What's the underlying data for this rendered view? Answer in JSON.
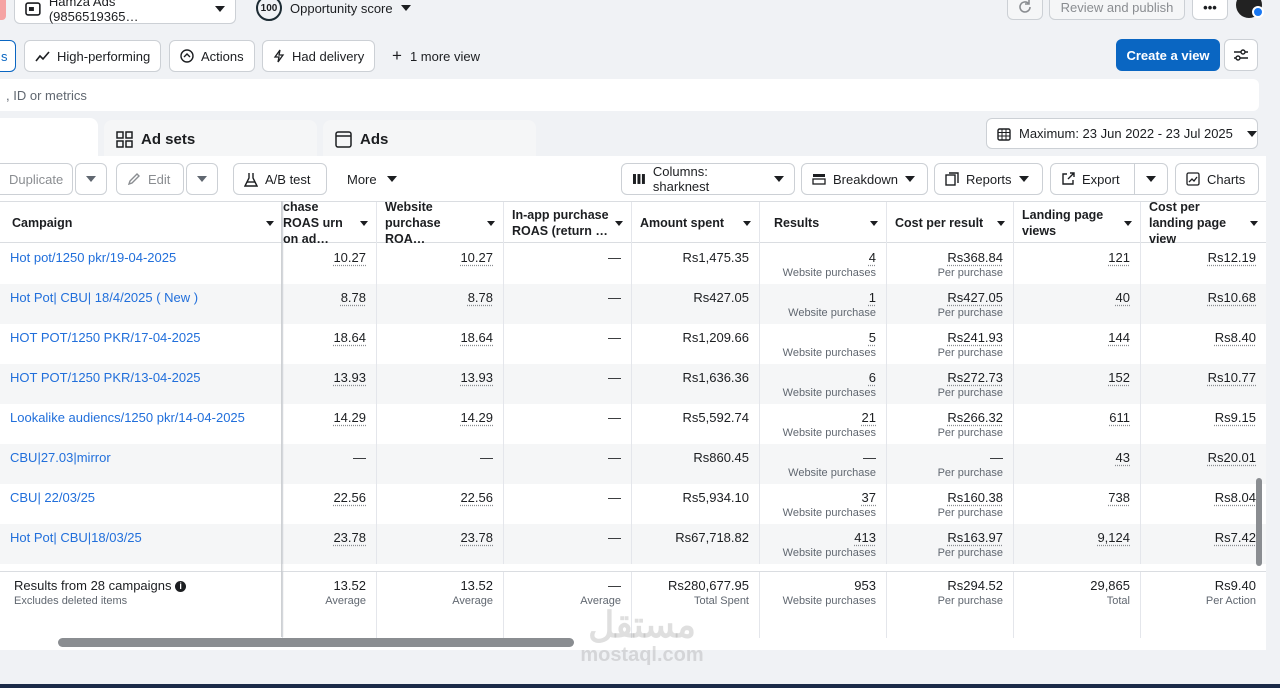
{
  "topbar": {
    "account": "Hamza Ads (9856519365…",
    "opportunity_score": "100",
    "opportunity_label": "Opportunity score",
    "review_publish": "Review and publish",
    "more_dots": "•••"
  },
  "views": {
    "truncated_first": "s",
    "high_performing": "High-performing",
    "actions": "Actions",
    "had_delivery": "Had delivery",
    "more_view": "1 more view",
    "create_view": "Create a view"
  },
  "search": {
    "placeholder": ", ID or metrics"
  },
  "level_tabs": {
    "ad_sets": "Ad sets",
    "ads": "Ads"
  },
  "date_range": "Maximum: 23 Jun 2022 - 23 Jul 2025",
  "toolbar": {
    "duplicate": "Duplicate",
    "edit": "Edit",
    "ab_test": "A/B test",
    "more": "More",
    "columns": "Columns: sharknest",
    "breakdown": "Breakdown",
    "reports": "Reports",
    "export": "Export",
    "charts": "Charts"
  },
  "table": {
    "headers": {
      "campaign": "Campaign",
      "purchase_roas": "chase ROAS urn on ad…",
      "website_roas": "Website purchase ROA…",
      "inapp_roas": "In-app purchase ROAS (return …",
      "amount_spent": "Amount spent",
      "results": "Results",
      "cost_per_result": "Cost per result",
      "lp_views": "Landing page views",
      "cost_per_lpv": "Cost per landing page view"
    },
    "rows": [
      {
        "campaign": "Hot pot/1250 pkr/19-04-2025",
        "roas": "10.27",
        "web_roas": "10.27",
        "inapp": "—",
        "spent": "Rs1,475.35",
        "results": "4",
        "results_sub": "Website purchases",
        "cpr": "Rs368.84",
        "cpr_sub": "Per purchase",
        "lpv": "121",
        "cplpv": "Rs12.19"
      },
      {
        "campaign": "Hot Pot| CBU| 18/4/2025 ( New )",
        "roas": "8.78",
        "web_roas": "8.78",
        "inapp": "—",
        "spent": "Rs427.05",
        "results": "1",
        "results_sub": "Website purchase",
        "cpr": "Rs427.05",
        "cpr_sub": "Per purchase",
        "lpv": "40",
        "cplpv": "Rs10.68"
      },
      {
        "campaign": "HOT POT/1250 PKR/17-04-2025",
        "roas": "18.64",
        "web_roas": "18.64",
        "inapp": "—",
        "spent": "Rs1,209.66",
        "results": "5",
        "results_sub": "Website purchases",
        "cpr": "Rs241.93",
        "cpr_sub": "Per purchase",
        "lpv": "144",
        "cplpv": "Rs8.40"
      },
      {
        "campaign": "HOT POT/1250 PKR/13-04-2025",
        "roas": "13.93",
        "web_roas": "13.93",
        "inapp": "—",
        "spent": "Rs1,636.36",
        "results": "6",
        "results_sub": "Website purchases",
        "cpr": "Rs272.73",
        "cpr_sub": "Per purchase",
        "lpv": "152",
        "cplpv": "Rs10.77"
      },
      {
        "campaign": "Lookalike audiencs/1250 pkr/14-04-2025",
        "roas": "14.29",
        "web_roas": "14.29",
        "inapp": "—",
        "spent": "Rs5,592.74",
        "results": "21",
        "results_sub": "Website purchases",
        "cpr": "Rs266.32",
        "cpr_sub": "Per purchase",
        "lpv": "611",
        "cplpv": "Rs9.15"
      },
      {
        "campaign": "CBU|27.03|mirror",
        "roas": "—",
        "web_roas": "—",
        "inapp": "—",
        "spent": "Rs860.45",
        "results": "—",
        "results_sub": "Website purchase",
        "cpr": "—",
        "cpr_sub": "Per purchase",
        "lpv": "43",
        "cplpv": "Rs20.01"
      },
      {
        "campaign": "CBU| 22/03/25",
        "roas": "22.56",
        "web_roas": "22.56",
        "inapp": "—",
        "spent": "Rs5,934.10",
        "results": "37",
        "results_sub": "Website purchases",
        "cpr": "Rs160.38",
        "cpr_sub": "Per purchase",
        "lpv": "738",
        "cplpv": "Rs8.04"
      },
      {
        "campaign": "Hot Pot| CBU|18/03/25",
        "roas": "23.78",
        "web_roas": "23.78",
        "inapp": "—",
        "spent": "Rs67,718.82",
        "results": "413",
        "results_sub": "Website purchases",
        "cpr": "Rs163.97",
        "cpr_sub": "Per purchase",
        "lpv": "9,124",
        "cplpv": "Rs7.42"
      }
    ],
    "totals": {
      "label": "Results from 28 campaigns",
      "label_sub": "Excludes deleted items",
      "roas": "13.52",
      "roas_sub": "Average",
      "web_roas": "13.52",
      "web_roas_sub": "Average",
      "inapp": "—",
      "inapp_sub": "Average",
      "spent": "Rs280,677.95",
      "spent_sub": "Total Spent",
      "results": "953",
      "results_sub": "Website purchases",
      "cpr": "Rs294.52",
      "cpr_sub": "Per purchase",
      "lpv": "29,865",
      "lpv_sub": "Total",
      "cplpv": "Rs9.40",
      "cplpv_sub": "Per Action"
    }
  },
  "watermark": {
    "arabic": "مستقل",
    "latin": "mostaql.com"
  },
  "colors": {
    "primary": "#0a66c2",
    "link": "#216fdb"
  }
}
